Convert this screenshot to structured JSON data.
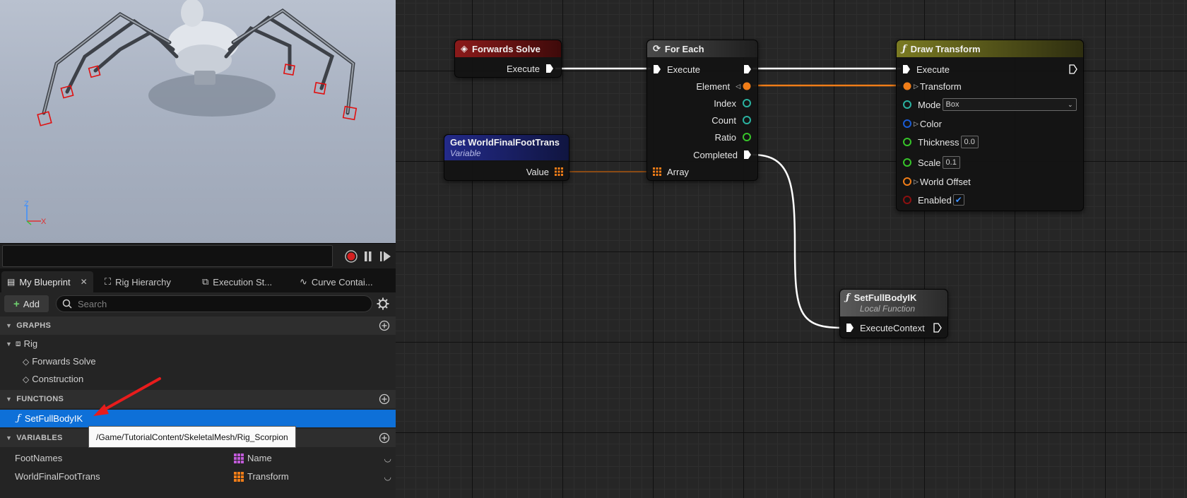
{
  "viewport": {
    "axis_labels": {
      "z": "Z",
      "x": "X"
    }
  },
  "tabs": [
    {
      "label": "My Blueprint",
      "close": "✕"
    },
    {
      "label": "Rig Hierarchy"
    },
    {
      "label": "Execution St..."
    },
    {
      "label": "Curve Contai..."
    }
  ],
  "toolbar": {
    "add_label": "Add",
    "search_placeholder": "Search"
  },
  "sections": {
    "graphs": "GRAPHS",
    "functions": "FUNCTIONS",
    "variables": "VARIABLES"
  },
  "graphs": {
    "root": "Rig",
    "items": [
      "Forwards Solve",
      "Construction"
    ]
  },
  "functions": [
    "SetFullBodyIK"
  ],
  "variables": [
    {
      "name": "FootNames",
      "type": "Name"
    },
    {
      "name": "WorldFinalFootTrans",
      "type": "Transform"
    }
  ],
  "tooltip": "/Game/TutorialContent/SkeletalMesh/Rig_Scorpion",
  "colors": {
    "selection": "#0e70d8",
    "exec_wire": "#ffffff",
    "transform_pin": "#f07d18",
    "struct_pin": "#2ab2a0",
    "float_pin": "#37c42a",
    "color_pin": "#1a5cd6",
    "bool_pin": "#8c1010"
  },
  "nodes": {
    "forwards_solve": {
      "title": "Forwards Solve",
      "execute": "Execute"
    },
    "for_each": {
      "title": "For Each",
      "execute": "Execute",
      "element": "Element",
      "index": "Index",
      "count": "Count",
      "ratio": "Ratio",
      "completed": "Completed",
      "array": "Array"
    },
    "get_var": {
      "title": "Get WorldFinalFootTrans",
      "subtitle": "Variable",
      "value": "Value"
    },
    "draw_transform": {
      "title": "Draw Transform",
      "execute": "Execute",
      "transform": "Transform",
      "mode": "Mode",
      "mode_value": "Box",
      "color": "Color",
      "thickness": "Thickness",
      "thickness_value": "0.0",
      "scale": "Scale",
      "scale_value": "0.1",
      "world_offset": "World Offset",
      "enabled": "Enabled"
    },
    "set_full_body": {
      "title": "SetFullBodyIK",
      "subtitle": "Local Function",
      "execute_context": "ExecuteContext"
    }
  }
}
